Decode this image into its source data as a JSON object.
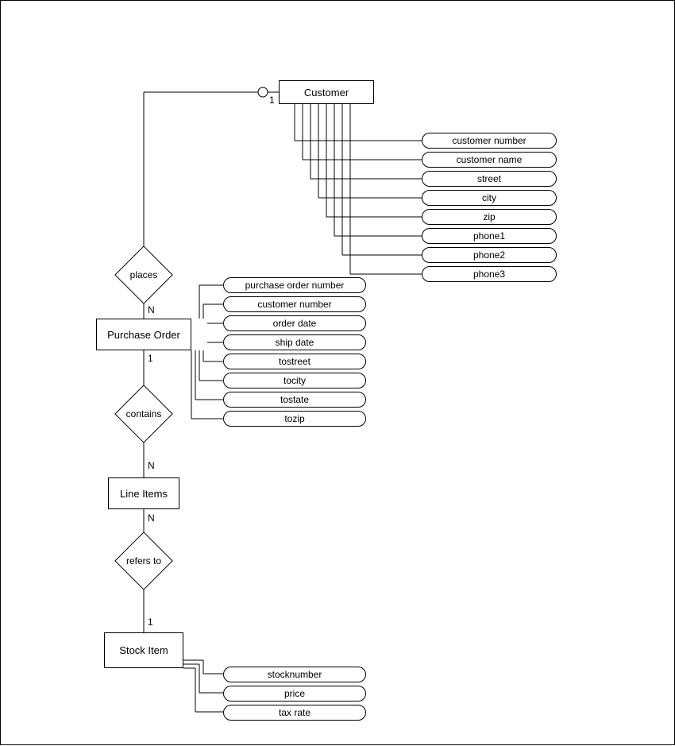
{
  "entities": {
    "customer": "Customer",
    "purchase_order": "Purchase Order",
    "line_items": "Line Items",
    "stock_item": "Stock Item"
  },
  "relationships": {
    "places": "places",
    "contains": "contains",
    "refers_to": "refers to"
  },
  "cardinalities": {
    "customer_places": "1",
    "places_po": "N",
    "po_contains": "1",
    "contains_li": "N",
    "li_refers": "N",
    "refers_si": "1"
  },
  "attrs": {
    "customer": [
      "customer number",
      "customer name",
      "street",
      "city",
      "zip",
      "phone1",
      "phone2",
      "phone3"
    ],
    "purchase_order": [
      "purchase order number",
      "customer number",
      "order date",
      "ship date",
      "tostreet",
      "tocity",
      "tostate",
      "tozip"
    ],
    "stock_item": [
      "stocknumber",
      "price",
      "tax rate"
    ]
  }
}
